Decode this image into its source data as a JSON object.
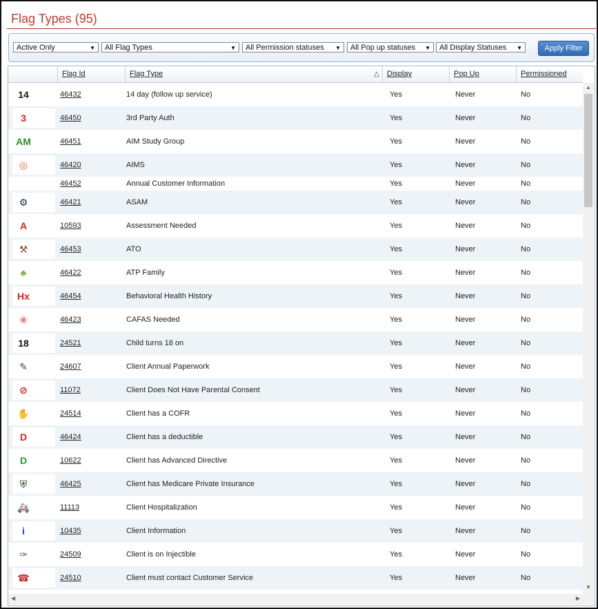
{
  "page": {
    "title": "Flag Types (95)"
  },
  "filters": {
    "active": "Active Only",
    "flag_types": "All Flag Types",
    "permission": "All Permission statuses",
    "popup": "All Pop up statuses",
    "display": "All Display Statuses",
    "apply_label": "Apply Filter"
  },
  "columns": {
    "flag_id": "Flag Id",
    "flag_type": "Flag Type",
    "display": "Display",
    "popup": "Pop Up",
    "permissioned": "Permissioned"
  },
  "rows": [
    {
      "icon": "calendar-14-icon",
      "glyph": "14",
      "color": "#1a1a1a",
      "id": "46432",
      "type": "14 day (follow up service)",
      "display": "Yes",
      "popup": "Never",
      "perm": "No"
    },
    {
      "icon": "red-3-badge-icon",
      "glyph": "3",
      "color": "#d62020",
      "id": "46450",
      "type": "3rd Party Auth",
      "display": "Yes",
      "popup": "Never",
      "perm": "No"
    },
    {
      "icon": "aim-logo-icon",
      "glyph": "AM",
      "color": "#2e8b22",
      "id": "46451",
      "type": "AIM Study Group",
      "display": "Yes",
      "popup": "Never",
      "perm": "No"
    },
    {
      "icon": "target-icon",
      "glyph": "◎",
      "color": "#e0603a",
      "id": "46420",
      "type": "AIMS",
      "display": "Yes",
      "popup": "Never",
      "perm": "No"
    },
    {
      "icon": "",
      "glyph": "",
      "color": "#000000",
      "id": "46452",
      "type": "Annual Customer Information",
      "display": "Yes",
      "popup": "Never",
      "perm": "No"
    },
    {
      "icon": "asam-seal-icon",
      "glyph": "⚙",
      "color": "#1b2a4a",
      "id": "46421",
      "type": "ASAM",
      "display": "Yes",
      "popup": "Never",
      "perm": "No"
    },
    {
      "icon": "letter-a-icon",
      "glyph": "A",
      "color": "#d62020",
      "id": "10593",
      "type": "Assessment Needed",
      "display": "Yes",
      "popup": "Never",
      "perm": "No"
    },
    {
      "icon": "gavel-icon",
      "glyph": "⚒",
      "color": "#8b4a1c",
      "id": "46453",
      "type": "ATO",
      "display": "Yes",
      "popup": "Never",
      "perm": "No"
    },
    {
      "icon": "tree-icon",
      "glyph": "♣",
      "color": "#7cb342",
      "id": "46422",
      "type": "ATP Family",
      "display": "Yes",
      "popup": "Never",
      "perm": "No"
    },
    {
      "icon": "hx-icon",
      "glyph": "Hx",
      "color": "#d62020",
      "id": "46454",
      "type": "Behavioral Health History",
      "display": "Yes",
      "popup": "Never",
      "perm": "No"
    },
    {
      "icon": "cafas-icon",
      "glyph": "❀",
      "color": "#e57373",
      "id": "46423",
      "type": "CAFAS Needed",
      "display": "Yes",
      "popup": "Never",
      "perm": "No"
    },
    {
      "icon": "eighteen-circle-icon",
      "glyph": "18",
      "color": "#111111",
      "id": "24521",
      "type": "Child turns 18 on",
      "display": "Yes",
      "popup": "Never",
      "perm": "No"
    },
    {
      "icon": "paper-pencil-icon",
      "glyph": "✎",
      "color": "#444444",
      "id": "24607",
      "type": "Client Annual Paperwork",
      "display": "Yes",
      "popup": "Never",
      "perm": "No"
    },
    {
      "icon": "no-consent-icon",
      "glyph": "⊘",
      "color": "#d62020",
      "id": "11072",
      "type": "Client Does Not Have Parental Consent",
      "display": "Yes",
      "popup": "Never",
      "perm": "No"
    },
    {
      "icon": "michigan-map-icon",
      "glyph": "✋",
      "color": "#1a237e",
      "id": "24514",
      "type": "Client has a COFR",
      "display": "Yes",
      "popup": "Never",
      "perm": "No"
    },
    {
      "icon": "red-d-badge-icon",
      "glyph": "D",
      "color": "#d62020",
      "id": "46424",
      "type": "Client has a deductible",
      "display": "Yes",
      "popup": "Never",
      "perm": "No"
    },
    {
      "icon": "green-d-badge-icon",
      "glyph": "D",
      "color": "#1f9d35",
      "id": "10622",
      "type": "Client has Advanced Directive",
      "display": "Yes",
      "popup": "Never",
      "perm": "No"
    },
    {
      "icon": "shield-icon",
      "glyph": "⛨",
      "color": "#5a7a5a",
      "id": "46425",
      "type": "Client has Medicare Private Insurance",
      "display": "Yes",
      "popup": "Never",
      "perm": "No"
    },
    {
      "icon": "ambulance-icon",
      "glyph": "🚑",
      "color": "#c62828",
      "id": "11113",
      "type": "Client Hospitalization",
      "display": "Yes",
      "popup": "Never",
      "perm": "No"
    },
    {
      "icon": "info-icon",
      "glyph": "i",
      "color": "#1a3fcf",
      "id": "10435",
      "type": "Client Information",
      "display": "Yes",
      "popup": "Never",
      "perm": "No"
    },
    {
      "icon": "syringe-icon",
      "glyph": "✑",
      "color": "#555555",
      "id": "24509",
      "type": "Client is on Injectible",
      "display": "Yes",
      "popup": "Never",
      "perm": "No"
    },
    {
      "icon": "phone-icon",
      "glyph": "☎",
      "color": "#c62828",
      "id": "24510",
      "type": "Client must contact Customer Service",
      "display": "Yes",
      "popup": "Never",
      "perm": "No"
    }
  ]
}
